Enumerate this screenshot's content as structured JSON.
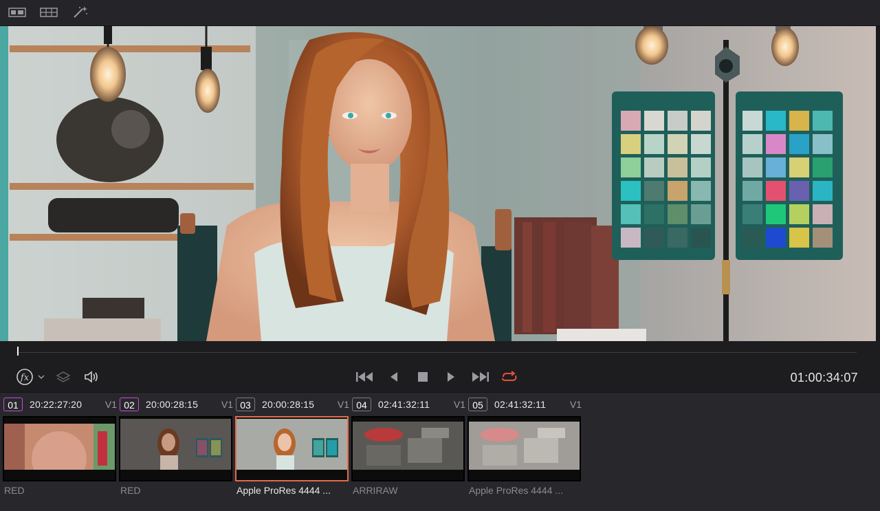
{
  "toolbar": {
    "icons": [
      "single-viewer-icon",
      "grid-viewer-icon",
      "magic-wand-icon"
    ]
  },
  "viewer": {
    "description_icon": "video-frame"
  },
  "transport": {
    "icons": [
      "fx-icon",
      "chevron-down-icon",
      "layers-icon",
      "speaker-icon",
      "skip-to-start-icon",
      "step-back-icon",
      "stop-icon",
      "play-icon",
      "skip-to-end-icon",
      "loop-icon"
    ],
    "loop_color": "#e8513a",
    "timecode": "01:00:34:07"
  },
  "clips": [
    {
      "num": "01",
      "timecode": "20:22:27:20",
      "track": "V1",
      "codec": "RED",
      "num_color": "#d24ad8",
      "selected": false
    },
    {
      "num": "02",
      "timecode": "20:00:28:15",
      "track": "V1",
      "codec": "RED",
      "num_color": "#d24ad8",
      "selected": false
    },
    {
      "num": "03",
      "timecode": "20:00:28:15",
      "track": "V1",
      "codec": "Apple ProRes 4444 ...",
      "num_color": "#7a7a80",
      "selected": true
    },
    {
      "num": "04",
      "timecode": "02:41:32:11",
      "track": "V1",
      "codec": "ARRIRAW",
      "num_color": "#7a7a80",
      "selected": false
    },
    {
      "num": "05",
      "timecode": "02:41:32:11",
      "track": "V1",
      "codec": "Apple ProRes 4444 ...",
      "num_color": "#7a7a80",
      "selected": false
    }
  ],
  "colors": {
    "accent_selection": "#e56a4a",
    "clip_num_rgb_border": "#c84ad8"
  }
}
